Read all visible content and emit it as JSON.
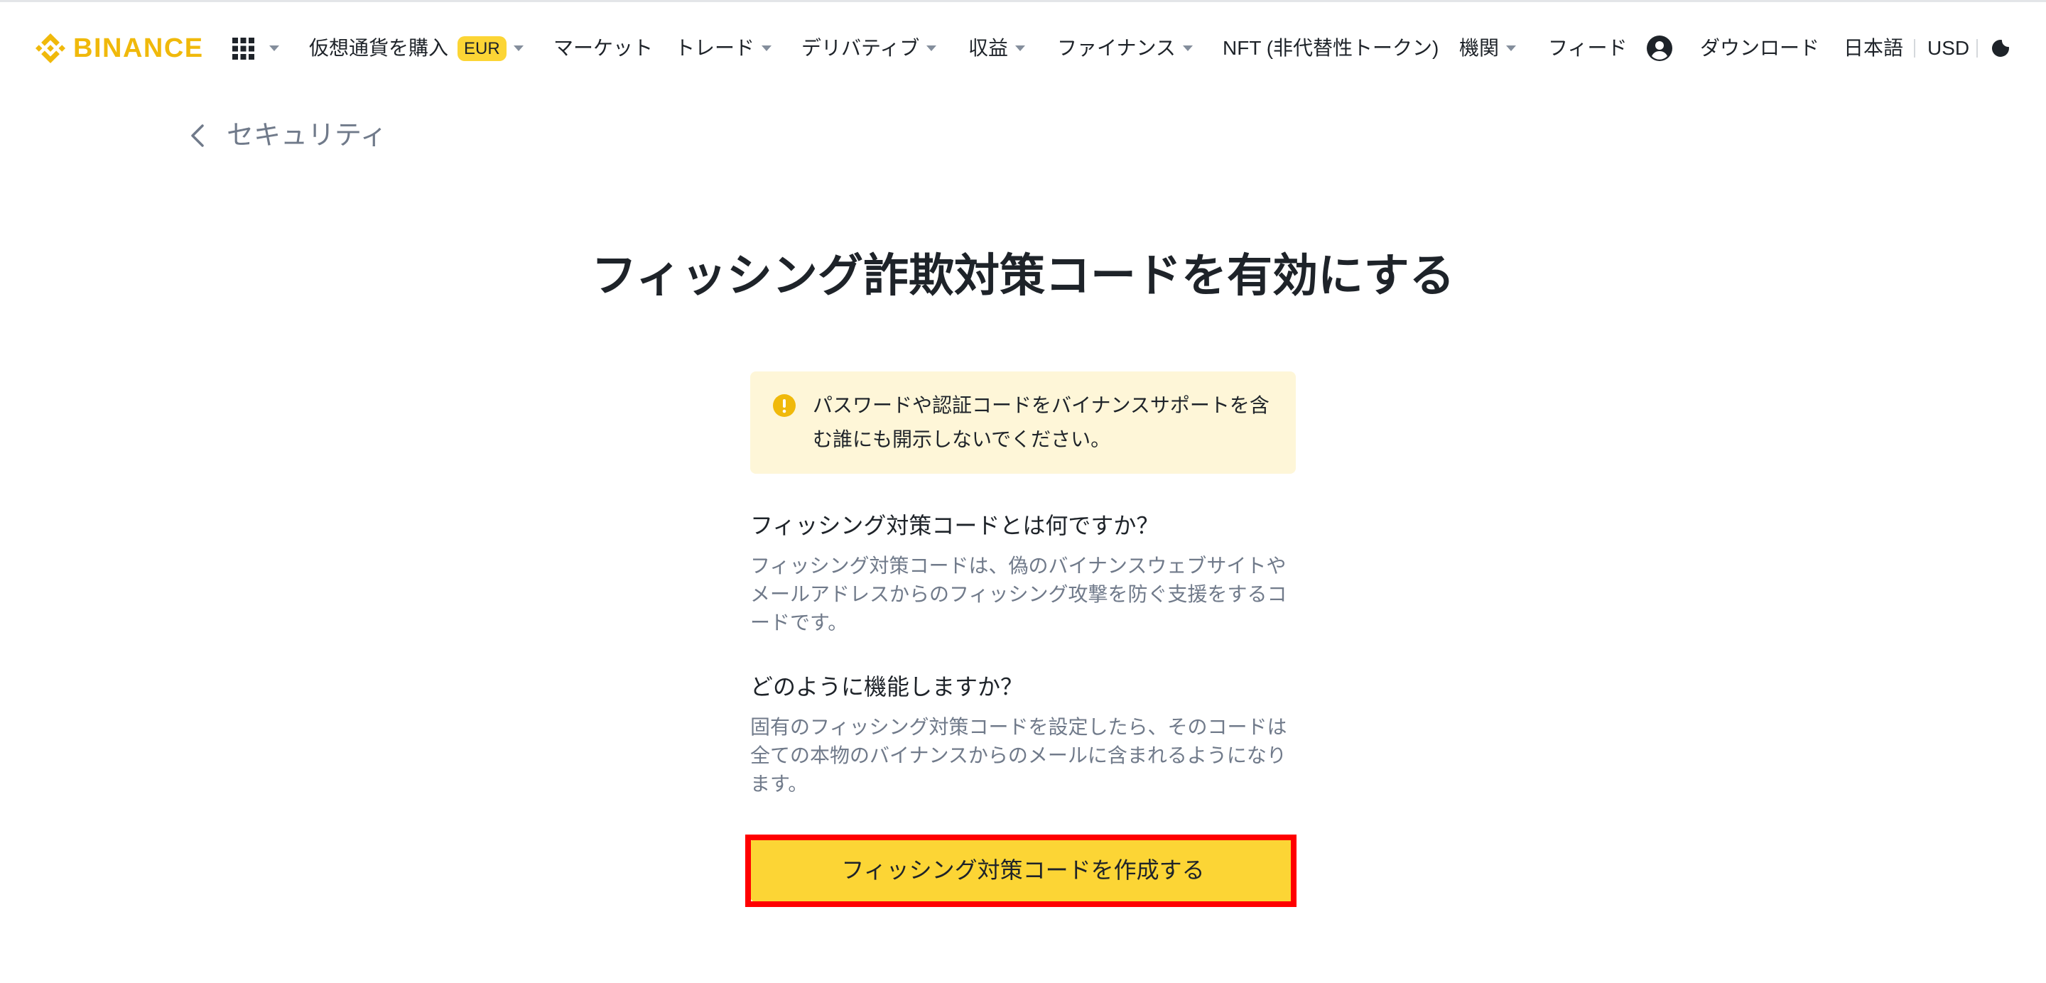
{
  "colors": {
    "brand": "#F0B90B",
    "text_primary": "#1E2329",
    "text_secondary": "#707A8A",
    "button_bg": "#FCD535",
    "warning_bg": "#FEF6D8",
    "annotation": "#FF0000"
  },
  "header": {
    "logo": {
      "icon": "binance-logo-icon",
      "text": "BINANCE"
    },
    "apps_icon": "grid-icon",
    "nav": [
      {
        "label": "仮想通貨を購入",
        "badge": "EUR",
        "has_dropdown": true
      },
      {
        "label": "マーケット",
        "has_dropdown": false
      },
      {
        "label": "トレード",
        "has_dropdown": true
      },
      {
        "label": "デリバティブ",
        "has_dropdown": true
      },
      {
        "label": "収益",
        "has_dropdown": true
      },
      {
        "label": "ファイナンス",
        "has_dropdown": true
      },
      {
        "label": "NFT (非代替性トークン)",
        "has_dropdown": false
      },
      {
        "label": "機関",
        "has_dropdown": true
      },
      {
        "label": "フィード",
        "has_dropdown": false
      }
    ],
    "profile_icon": "user-circle-icon",
    "download": "ダウンロード",
    "language": "日本語",
    "currency": "USD",
    "theme_icon": "moon-icon"
  },
  "breadcrumb": {
    "back_icon": "chevron-left-icon",
    "label": "セキュリティ"
  },
  "main": {
    "title": "フィッシング詐欺対策コードを有効にする",
    "warning": {
      "icon": "exclamation-circle-icon",
      "lines": [
        "パスワードや認証コードをバイナンスサポートを含",
        "む誰にも開示しないでください。"
      ]
    },
    "sections": [
      {
        "heading": "フィッシング対策コードとは何ですか？",
        "lines": [
          "フィッシング対策コードは、偽のバイナンスウェブサイトや",
          "メールアドレスからのフィッシング攻撃を防ぐ支援をするコ",
          "ードです。"
        ]
      },
      {
        "heading": "どのように機能しますか？",
        "lines": [
          "固有のフィッシング対策コードを設定したら、そのコードは",
          "全ての本物のバイナンスからのメールに含まれるようになり",
          "ます。"
        ]
      }
    ],
    "cta_label": "フィッシング対策コードを作成する"
  }
}
